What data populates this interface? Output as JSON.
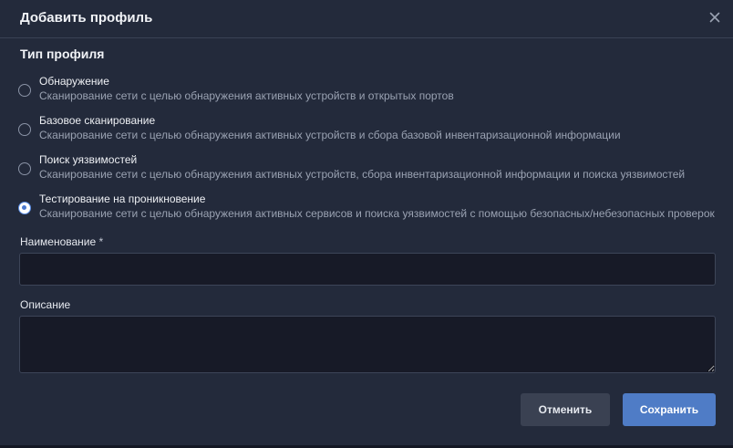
{
  "dialog": {
    "title": "Добавить профиль",
    "close_icon": "close-icon"
  },
  "profile_type": {
    "title": "Тип профиля",
    "selected": 3,
    "options": [
      {
        "label": "Обнаружение",
        "description": "Сканирование сети с целью обнаружения активных устройств и открытых портов"
      },
      {
        "label": "Базовое сканирование",
        "description": "Сканирование сети с целью обнаружения активных устройств и сбора базовой инвентаризационной информации"
      },
      {
        "label": "Поиск уязвимостей",
        "description": "Сканирование сети с целью обнаружения активных устройств, сбора инвентаризационной информации и поиска уязвимостей"
      },
      {
        "label": "Тестирование на проникновение",
        "description": "Сканирование сети с целью обнаружения активных сервисов и поиска уязвимостей с помощью безопасных/небезопасных проверок"
      }
    ]
  },
  "name_field": {
    "label": "Наименование",
    "required_mark": "*",
    "value": ""
  },
  "description_field": {
    "label": "Описание",
    "value": ""
  },
  "buttons": {
    "cancel": "Отменить",
    "save": "Сохранить"
  },
  "colors": {
    "background": "#232a3b",
    "input_background": "#171a27",
    "accent": "#4f7cc6",
    "cancel_button": "#3a4152"
  }
}
